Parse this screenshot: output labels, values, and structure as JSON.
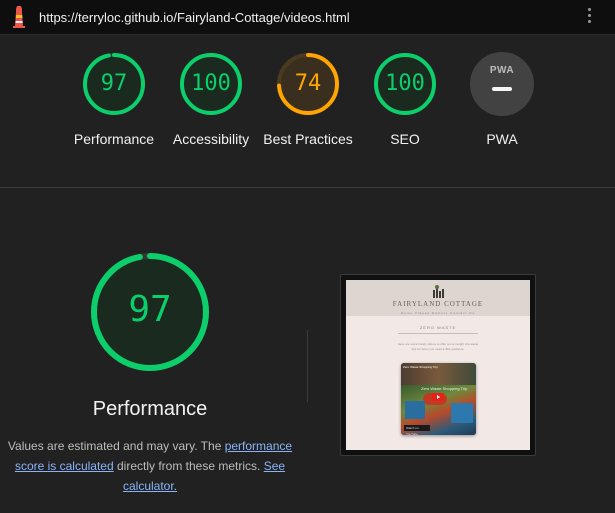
{
  "topbar": {
    "url": "https://terryloc.github.io/Fairyland-Cottage/videos.html",
    "logo_icon": "lighthouse-icon",
    "menu_icon": "kebab-menu-icon"
  },
  "colors": {
    "pass": "#0cce6b",
    "average": "#ffa400",
    "pass_bg": "#1b2a1f",
    "average_bg": "#3a2f1f",
    "track": "#2f3a33"
  },
  "scores": [
    {
      "label": "Performance",
      "score": 97,
      "status": "pass"
    },
    {
      "label": "Accessibility",
      "score": 100,
      "status": "pass"
    },
    {
      "label": "Best Practices",
      "score": 74,
      "status": "average"
    },
    {
      "label": "SEO",
      "score": 100,
      "status": "pass"
    },
    {
      "label": "PWA",
      "score": null,
      "status": "na",
      "badge_text": "PWA"
    }
  ],
  "main": {
    "score": 97,
    "title": "Performance",
    "desc_before": "Values are estimated and may vary. The ",
    "link1": "performance score is calculated",
    "desc_middle": " directly from these metrics. ",
    "link2": "See calculator."
  },
  "screenshot": {
    "brand": "FAIRYLAND COTTAGE",
    "nav": "Home   Videos   Gallery   Contact Us",
    "section": "ZERO WASTE",
    "paragraph": "Here are some handy videos to offer some insight into waste tips for when you need a little guidance.",
    "video_title": "Zero Waste Shopping Trip",
    "video_button": "Watch on YouTube"
  }
}
